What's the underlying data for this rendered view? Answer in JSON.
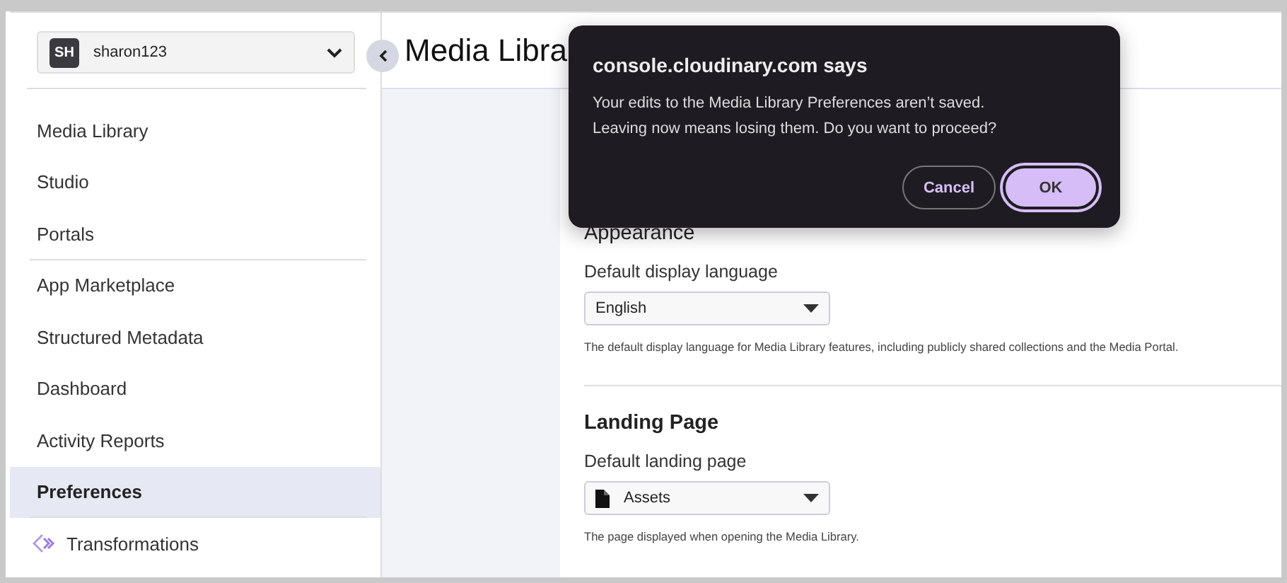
{
  "account": {
    "initials": "SH",
    "name": "sharon123"
  },
  "sidebar": {
    "items": [
      {
        "label": "Media Library",
        "kind": "plain",
        "selected": false,
        "divider_after": false
      },
      {
        "label": "Studio",
        "kind": "plain",
        "selected": false,
        "divider_after": false
      },
      {
        "label": "Portals",
        "kind": "plain",
        "selected": false,
        "divider_after": true
      },
      {
        "label": "App Marketplace",
        "kind": "plain",
        "selected": false,
        "divider_after": false
      },
      {
        "label": "Structured Metadata",
        "kind": "plain",
        "selected": false,
        "divider_after": false
      },
      {
        "label": "Dashboard",
        "kind": "plain",
        "selected": false,
        "divider_after": false
      },
      {
        "label": "Activity Reports",
        "kind": "plain",
        "selected": false,
        "divider_after": false
      },
      {
        "label": "Preferences",
        "kind": "plain",
        "selected": true,
        "divider_after": true
      },
      {
        "label": "Transformations",
        "kind": "with-icon",
        "selected": false,
        "divider_after": false
      }
    ]
  },
  "page_title": "Media Libra",
  "sections": [
    {
      "title": "Appearance",
      "field": {
        "label": "Default display language",
        "value": "English",
        "kind": "plain",
        "hint": "The default display language for Media Library features, including publicly shared collections and the Media Portal."
      }
    },
    {
      "title": "Landing Page",
      "field": {
        "label": "Default landing page",
        "value": "Assets",
        "kind": "with-icon",
        "hint": "The page displayed when opening the Media Library."
      }
    }
  ],
  "dialog": {
    "title": "console.cloudinary.com says",
    "message": [
      "Your edits to the Media Library Preferences aren’t saved.",
      "Leaving now means losing them. Do you want to proceed?"
    ],
    "buttons": [
      {
        "label": "Cancel",
        "kind": "secondary"
      },
      {
        "label": "OK",
        "kind": "primary"
      }
    ]
  }
}
